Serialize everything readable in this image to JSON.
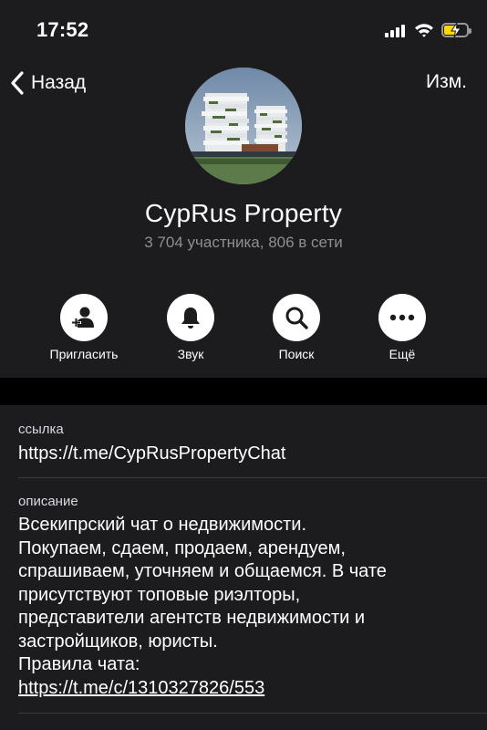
{
  "status_bar": {
    "time": "17:52",
    "battery_color": "#ffd60a"
  },
  "nav": {
    "back_label": "Назад",
    "edit_label": "Изм."
  },
  "profile": {
    "name": "CypRus Property",
    "members": "3 704 участника, 806 в сети"
  },
  "actions": [
    {
      "label": "Пригласить",
      "icon": "add-user-icon"
    },
    {
      "label": "Звук",
      "icon": "bell-icon"
    },
    {
      "label": "Поиск",
      "icon": "search-icon"
    },
    {
      "label": "Ещё",
      "icon": "more-icon"
    }
  ],
  "info": {
    "link_title": "ссылка",
    "link_value": "https://t.me/CypRusPropertyChat",
    "description_title": "описание",
    "description_text": "Всекипрский чат о недвижимости.\nПокупаем, сдаем, продаем, арендуем,\nспрашиваем, уточняем и общаемся. В чате\nприсутствуют топовые риэлторы,\nпредставители агентств недвижимости и\nзастройщиков, юристы.\nПравила чата:",
    "rules_link": "https://t.me/c/1310327826/553"
  },
  "colors": {
    "background": "#000000",
    "panel": "#1c1c1e",
    "secondary_text": "#8e8e93",
    "separator": "#3a3a3c"
  }
}
